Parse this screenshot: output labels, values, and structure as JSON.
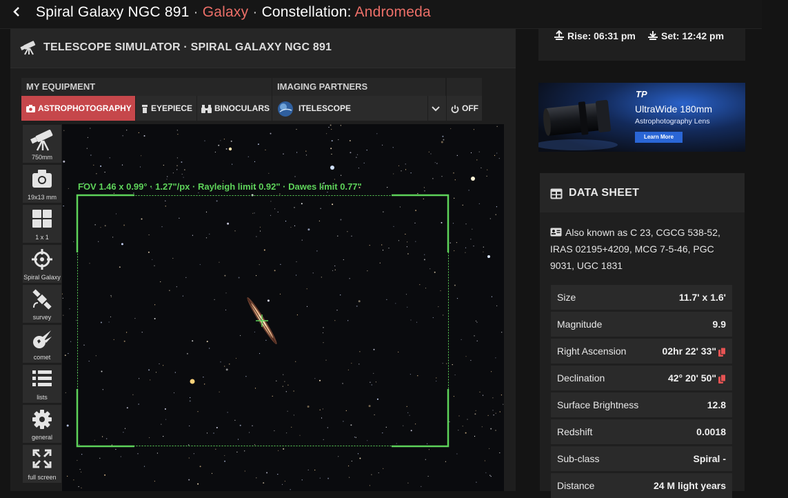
{
  "header": {
    "back_icon": "chevron-left-icon",
    "object_name": "Spiral Galaxy NGC 891",
    "sep": " · ",
    "object_type": "Galaxy",
    "constellation_prefix": "Constellation: ",
    "constellation": "Andromeda",
    "accent_color": "#ec6f68"
  },
  "simulator": {
    "title": "TELESCOPE SIMULATOR · SPIRAL GALAXY NGC 891",
    "icon": "telescope-icon",
    "my_equipment_label": "MY EQUIPMENT",
    "imaging_partners_label": "IMAGING PARTNERS",
    "buttons": {
      "astrophotography": "ASTROPHOTOGRAPHY",
      "eyepiece": "EYEPIECE",
      "binoculars": "BINOCULARS",
      "itelescope": "ITELESCOPE",
      "off": "OFF"
    },
    "active_color": "#c6474b",
    "fov_text": "FOV 1.46 x 0.99° · 1.27\"/px · Rayleigh limit 0.92\"  · Dawes limit 0.77\"",
    "fov_color": "#5ed35a",
    "sidebar": [
      {
        "label": "750mm",
        "icon": "telescope-icon"
      },
      {
        "label": "19x13 mm",
        "icon": "camera-icon"
      },
      {
        "label": "1 x 1",
        "icon": "grid-icon"
      },
      {
        "label": "Spiral Galaxy",
        "icon": "crosshair-icon"
      },
      {
        "label": "survey",
        "icon": "satellite-icon"
      },
      {
        "label": "comet",
        "icon": "comet-icon"
      },
      {
        "label": "lists",
        "icon": "list-icon"
      },
      {
        "label": "general",
        "icon": "gear-icon"
      },
      {
        "label": "full screen",
        "icon": "fullscreen-icon"
      }
    ]
  },
  "visibility": {
    "rise_label": "Rise: 06:31 pm",
    "set_label": "Set: 12:42 pm"
  },
  "ad": {
    "brand": "TP",
    "headline": "UltraWide 180mm",
    "subline": "Astrophotography Lens",
    "cta": "Learn More"
  },
  "datasheet": {
    "title": "DATA SHEET",
    "aka": "Also known as C 23, CGCG 538-52, IRAS 02195+4209, MCG 7-5-46, PGC 9031, UGC 1831",
    "rows": [
      {
        "key": "Size",
        "value": "11.7' x 1.6'"
      },
      {
        "key": "Magnitude",
        "value": "9.9"
      },
      {
        "key": "Right Ascension",
        "value": "02hr 22' 33\""
      },
      {
        "key": "Declination",
        "value": "42° 20' 50\""
      },
      {
        "key": "Surface Brightness",
        "value": "12.8"
      },
      {
        "key": "Redshift",
        "value": "0.0018"
      },
      {
        "key": "Sub-class",
        "value": "Spiral -"
      },
      {
        "key": "Distance",
        "value": "24 M light years"
      }
    ]
  }
}
